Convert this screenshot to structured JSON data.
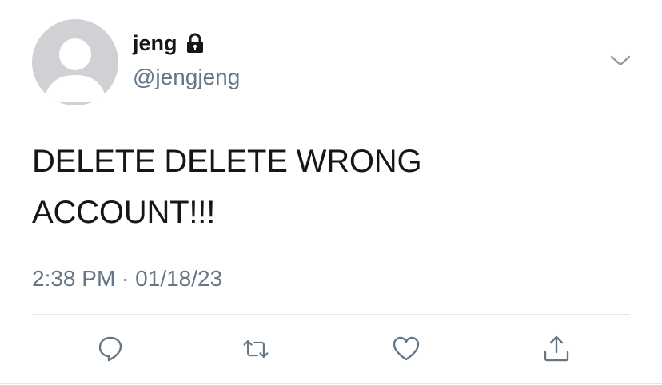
{
  "tweet": {
    "display_name": "jeng",
    "handle": "@jengjeng",
    "text_line1": "DELETE DELETE WRONG",
    "text_line2": "ACCOUNT!!!",
    "time": "2:38 PM",
    "separator": " · ",
    "date": "01/18/23"
  },
  "icons": {
    "avatar": "default-avatar-icon",
    "protected": "lock-icon",
    "menu": "chevron-down-icon",
    "reply": "reply-icon",
    "retweet": "retweet-icon",
    "like": "heart-icon",
    "share": "share-icon"
  },
  "colors": {
    "text": "#14171a",
    "secondary": "#657786",
    "avatar_bg": "#cfd1d4",
    "icon": "#657786",
    "divider": "#e1e8ed"
  }
}
